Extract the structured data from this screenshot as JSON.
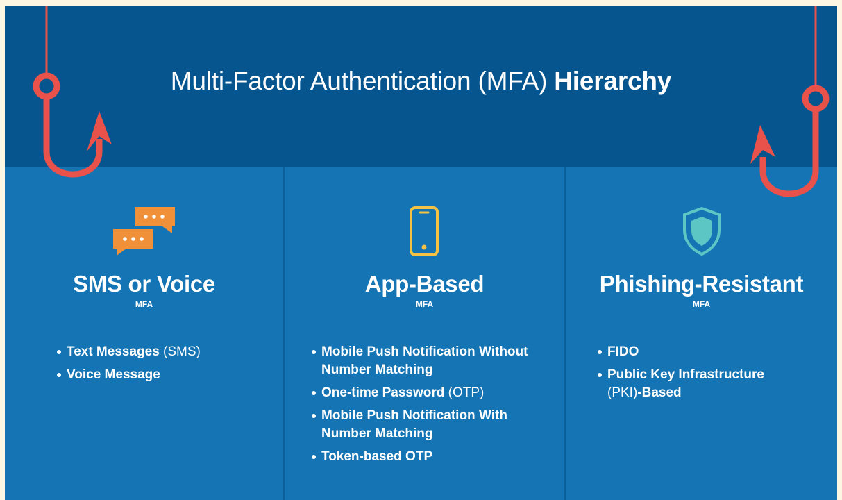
{
  "header": {
    "title_light": "Multi-Factor Authentication (MFA) ",
    "title_bold": "Hierarchy"
  },
  "columns": [
    {
      "title": "SMS or Voice",
      "subtitle": "MFA",
      "icon": "chat-bubbles-icon",
      "items": [
        {
          "bold": "Text Messages",
          "normal": " (SMS)"
        },
        {
          "bold": "Voice Message",
          "normal": ""
        }
      ]
    },
    {
      "title": "App-Based",
      "subtitle": "MFA",
      "icon": "smartphone-icon",
      "items": [
        {
          "bold": "Mobile Push Notification Without Number Matching",
          "normal": ""
        },
        {
          "bold": "One-time Password",
          "normal": " (OTP)"
        },
        {
          "bold": "Mobile Push Notification With Number Matching",
          "normal": ""
        },
        {
          "bold": "Token-based OTP",
          "normal": ""
        }
      ]
    },
    {
      "title": "Phishing-Resistant",
      "subtitle": "MFA",
      "icon": "shield-icon",
      "items": [
        {
          "bold": "FIDO",
          "normal": ""
        },
        {
          "bold": "Public Key Infrastructure",
          "normal": ""
        },
        {
          "bold": "",
          "normal": "(PKI)",
          "bold_after": "-Based"
        }
      ]
    }
  ],
  "colors": {
    "header_bg": "#06558e",
    "body_bg": "#1474b4",
    "hook": "#e8524a",
    "chat_icon": "#f0913a",
    "phone_icon": "#f6c244",
    "shield_icon": "#5cc6c4"
  }
}
